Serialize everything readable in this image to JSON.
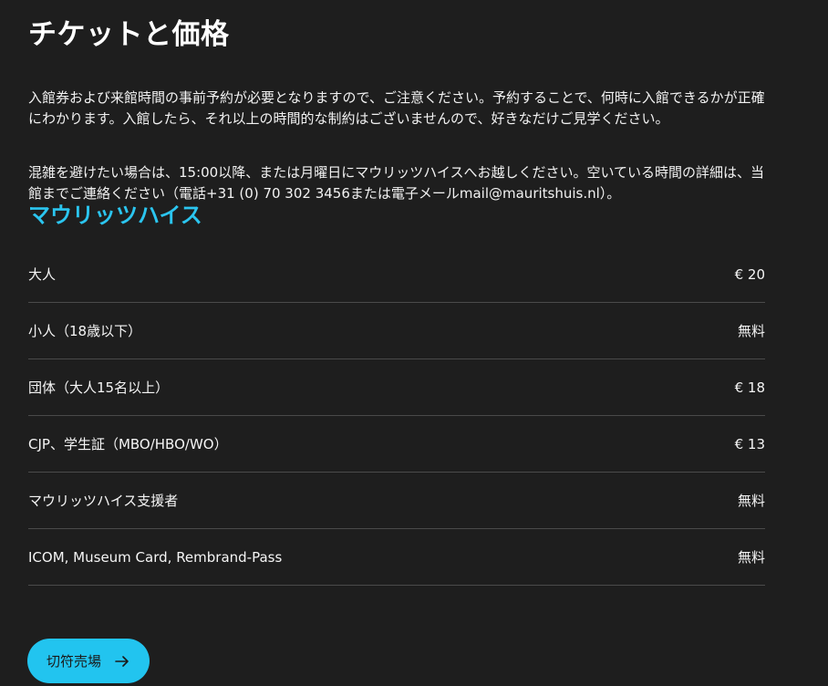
{
  "page": {
    "title": "チケットと価格",
    "paragraphs": [
      "入館券および来館時間の事前予約が必要となりますので、ご注意ください。予約することで、何時に入館できるかが正確にわかります。入館したら、それ以上の時間的な制約はございませんので、好きなだけご見学ください。",
      "混雑を避けたい場合は、15:00以降、または月曜日にマウリッツハイスへお越しください。空いている時間の詳細は、当館までご連絡ください（電話+31 (0) 70 302 3456または電子メールmail@mauritshuis.nl）。"
    ],
    "venue_title": "マウリッツハイス"
  },
  "prices": [
    {
      "label": "大人",
      "value": "€ 20"
    },
    {
      "label": "小人（18歳以下）",
      "value": "無料"
    },
    {
      "label": "団体（大人15名以上）",
      "value": "€ 18"
    },
    {
      "label": "CJP、学生証（MBO/HBO/WO）",
      "value": "€ 13"
    },
    {
      "label": "マウリッツハイス支援者",
      "value": "無料"
    },
    {
      "label": "ICOM, Museum Card, Rembrand-Pass",
      "value": "無料"
    }
  ],
  "ticket_button": {
    "label": "切符売場",
    "icon": "arrow-right-icon"
  },
  "colors": {
    "background": "#1e1e1e",
    "accent": "#22c4ef",
    "venue_text": "#2bc5ef",
    "divider": "#4a4a4a"
  }
}
